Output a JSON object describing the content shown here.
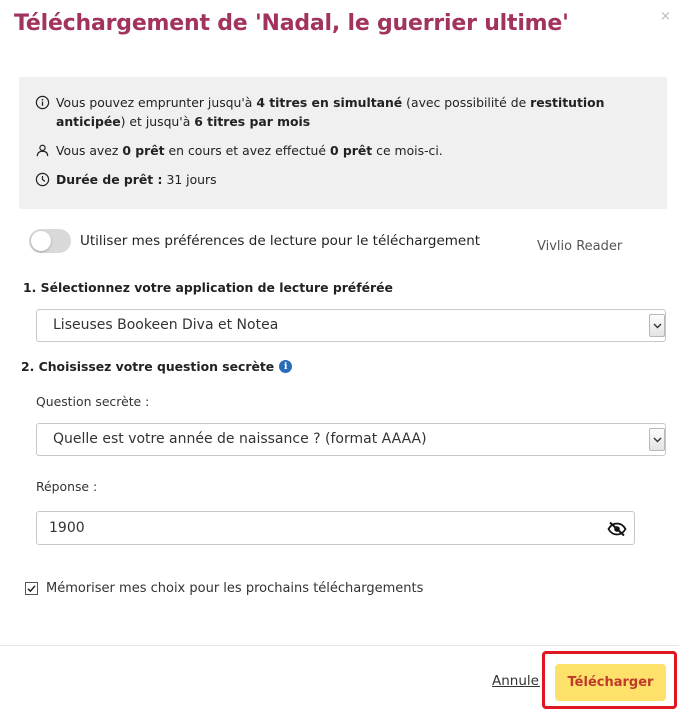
{
  "dialog": {
    "title": "Téléchargement de 'Nadal, le guerrier ultime'",
    "close_label": "×"
  },
  "info": {
    "line1": {
      "icon": "info-circle-icon",
      "parts": [
        "Vous pouvez emprunter jusqu'à ",
        "4 titres en simultané",
        " (avec possibilité de ",
        "restitution anticipée",
        ") et jusqu'à ",
        "6 titres par mois"
      ]
    },
    "line2": {
      "icon": "user-icon",
      "parts": [
        "Vous avez ",
        "0 prêt",
        " en cours et avez effectué ",
        "0 prêt",
        " ce mois-ci."
      ]
    },
    "line3": {
      "icon": "clock-icon",
      "parts": [
        "Durée de prêt :",
        " 31 jours"
      ]
    }
  },
  "preferences": {
    "toggle_label": "Utiliser mes préférences de lecture pour le téléchargement",
    "toggle_on": false,
    "reader_name": "Vivlio Reader"
  },
  "step1": {
    "heading": "1. Sélectionnez votre application de lecture préférée",
    "selected_app": "Liseuses Bookeen Diva et Notea"
  },
  "step2": {
    "heading": "2. Choisissez votre question secrète",
    "question_label": "Question secrète :",
    "selected_question": "Quelle est votre année de naissance ? (format AAAA)",
    "answer_label": "Réponse :",
    "answer_value": "1900"
  },
  "remember": {
    "label": "Mémoriser mes choix pour les prochains téléchargements",
    "checked": true
  },
  "footer": {
    "cancel_label": "Annuler",
    "download_label": "Télécharger"
  },
  "colors": {
    "title": "#a2325e",
    "download_bg": "#fde16a",
    "download_text": "#c0392b",
    "highlight_frame": "#e01620",
    "info_icon": "#2b6cb8"
  }
}
